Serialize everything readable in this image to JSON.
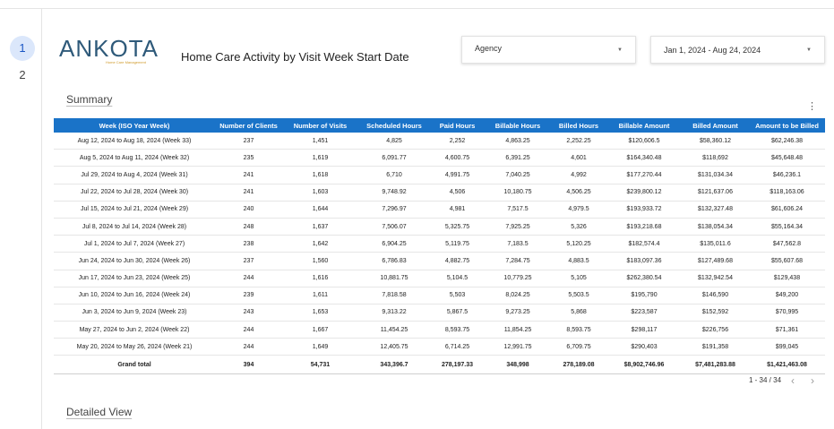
{
  "pages": [
    "1",
    "2"
  ],
  "logo": {
    "word": "ANKOTA",
    "tagline": "Home Care Management"
  },
  "report_title": "Home Care Activity by Visit Week Start Date",
  "filters": {
    "agency": "Agency",
    "date_range": "Jan 1, 2024 - Aug 24, 2024"
  },
  "sections": {
    "summary": "Summary",
    "detailed": "Detailed View"
  },
  "table": {
    "headers": [
      "Week (ISO Year Week)",
      "Number of Clients",
      "Number of Visits",
      "Scheduled Hours",
      "Paid Hours",
      "Billable Hours",
      "Billed Hours",
      "Billable Amount",
      "Billed Amount",
      "Amount to be Billed"
    ],
    "rows": [
      [
        "Aug 12, 2024 to Aug 18, 2024 (Week 33)",
        "237",
        "1,451",
        "4,825",
        "2,252",
        "4,863.25",
        "2,252.25",
        "$120,606.5",
        "$58,360.12",
        "$62,246.38"
      ],
      [
        "Aug 5, 2024 to Aug 11, 2024 (Week 32)",
        "235",
        "1,619",
        "6,091.77",
        "4,600.75",
        "6,391.25",
        "4,601",
        "$164,340.48",
        "$118,692",
        "$45,648.48"
      ],
      [
        "Jul 29, 2024 to Aug 4, 2024 (Week 31)",
        "241",
        "1,618",
        "6,710",
        "4,991.75",
        "7,040.25",
        "4,992",
        "$177,270.44",
        "$131,034.34",
        "$46,236.1"
      ],
      [
        "Jul 22, 2024 to Jul 28, 2024 (Week 30)",
        "241",
        "1,603",
        "9,748.92",
        "4,506",
        "10,180.75",
        "4,506.25",
        "$239,800.12",
        "$121,637.06",
        "$118,163.06"
      ],
      [
        "Jul 15, 2024 to Jul 21, 2024 (Week 29)",
        "240",
        "1,644",
        "7,296.97",
        "4,981",
        "7,517.5",
        "4,979.5",
        "$193,933.72",
        "$132,327.48",
        "$61,606.24"
      ],
      [
        "Jul 8, 2024 to Jul 14, 2024 (Week 28)",
        "248",
        "1,637",
        "7,506.07",
        "5,325.75",
        "7,925.25",
        "5,326",
        "$193,218.68",
        "$138,054.34",
        "$55,164.34"
      ],
      [
        "Jul 1, 2024 to Jul 7, 2024 (Week 27)",
        "238",
        "1,642",
        "6,904.25",
        "5,119.75",
        "7,183.5",
        "5,120.25",
        "$182,574.4",
        "$135,011.6",
        "$47,562.8"
      ],
      [
        "Jun 24, 2024 to Jun 30, 2024 (Week 26)",
        "237",
        "1,560",
        "6,786.83",
        "4,882.75",
        "7,284.75",
        "4,883.5",
        "$183,097.36",
        "$127,489.68",
        "$55,607.68"
      ],
      [
        "Jun 17, 2024 to Jun 23, 2024 (Week 25)",
        "244",
        "1,616",
        "10,881.75",
        "5,104.5",
        "10,779.25",
        "5,105",
        "$262,380.54",
        "$132,942.54",
        "$129,438"
      ],
      [
        "Jun 10, 2024 to Jun 16, 2024 (Week 24)",
        "239",
        "1,611",
        "7,818.58",
        "5,503",
        "8,024.25",
        "5,503.5",
        "$195,790",
        "$146,590",
        "$49,200"
      ],
      [
        "Jun 3, 2024 to Jun 9, 2024 (Week 23)",
        "243",
        "1,653",
        "9,313.22",
        "5,867.5",
        "9,273.25",
        "5,868",
        "$223,587",
        "$152,592",
        "$70,995"
      ],
      [
        "May 27, 2024 to Jun 2, 2024 (Week 22)",
        "244",
        "1,667",
        "11,454.25",
        "8,593.75",
        "11,854.25",
        "8,593.75",
        "$298,117",
        "$226,756",
        "$71,361"
      ],
      [
        "May 20, 2024 to May 26, 2024 (Week 21)",
        "244",
        "1,649",
        "12,405.75",
        "6,714.25",
        "12,991.75",
        "6,709.75",
        "$290,403",
        "$191,358",
        "$99,045"
      ]
    ],
    "total": [
      "Grand total",
      "394",
      "54,731",
      "343,396.7",
      "278,197.33",
      "348,998",
      "278,189.08",
      "$8,902,746.96",
      "$7,481,283.88",
      "$1,421,463.08"
    ]
  },
  "pagination": {
    "range": "1 - 34 / 34",
    "prev_icon": "chevron-left-icon",
    "next_icon": "chevron-right-icon"
  },
  "colors": {
    "header_bg": "#1a73c8",
    "active_page_bg": "#dbe7fb",
    "logo_blue": "#2f5a7a",
    "logo_gold": "#d09a2a"
  }
}
